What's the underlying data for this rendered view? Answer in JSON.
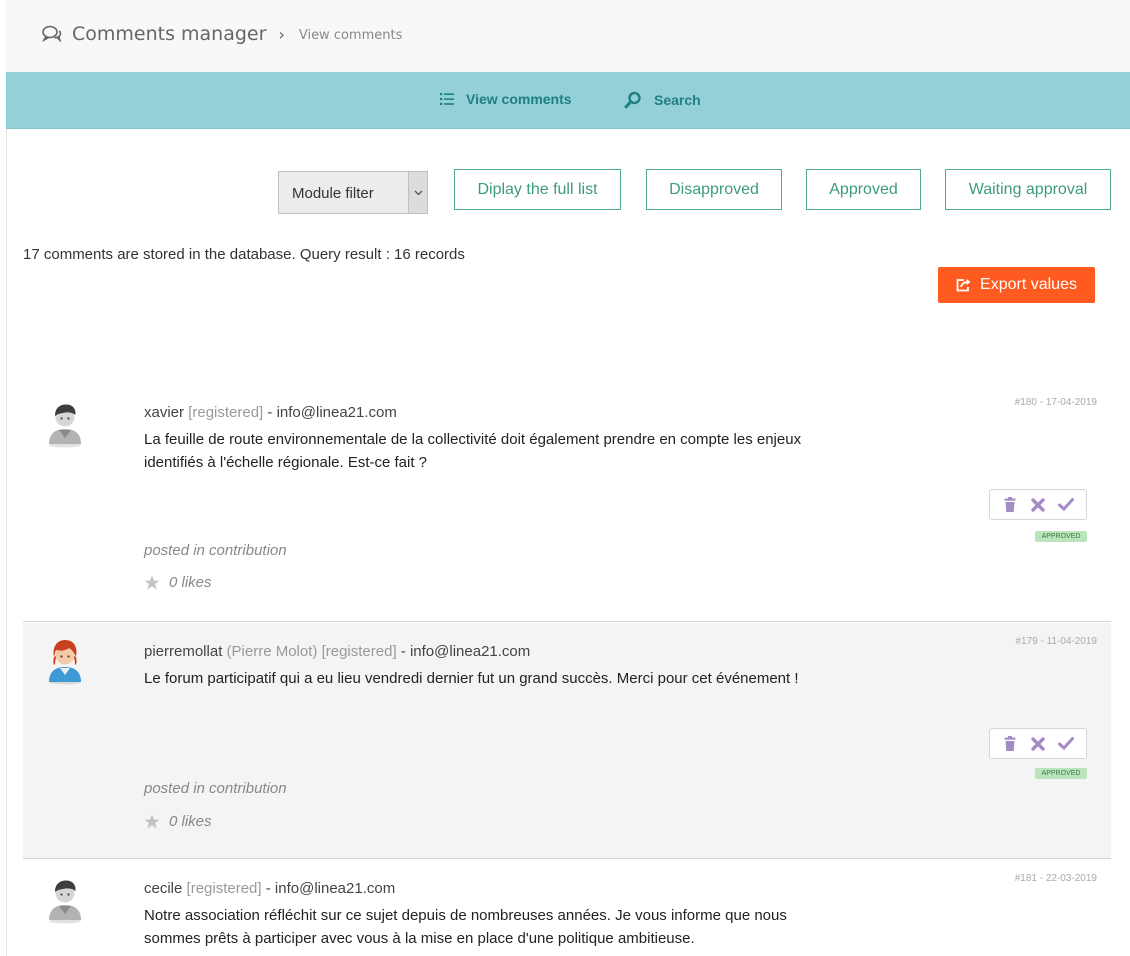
{
  "breadcrumb": {
    "icon": "comments-icon",
    "title": "Comments manager",
    "separator": "›",
    "current": "View comments"
  },
  "tabs": [
    {
      "label": "View comments",
      "icon": "list-icon"
    },
    {
      "label": "Search",
      "icon": "search-icon"
    }
  ],
  "filters": {
    "module_select": "Module filter",
    "buttons": [
      "Diplay the full list",
      "Disapproved",
      "Approved",
      "Waiting approval"
    ]
  },
  "summary": "17 comments are stored in the database. Query result : 16 records",
  "export_label": "Export values",
  "colors": {
    "tabbar": "#93d1d6",
    "accent_green": "#3d9c79",
    "export": "#ff5a1f",
    "action_purple": "#a58bc4"
  },
  "comments": [
    {
      "user": "xavier",
      "fullname": "",
      "status": "[registered]",
      "email": "- info@linea21.com",
      "text": "La feuille de route environnementale de la collectivité doit également prendre en compte les enjeux identifiés à l'échelle régionale. Est-ce fait ?",
      "meta": "#180 - 17-04-2019",
      "badge": "APPROVED",
      "posted": "posted in contribution",
      "likes": "0 likes"
    },
    {
      "user": "pierremollat",
      "fullname": "(Pierre Molot)",
      "status": "[registered]",
      "email": "- info@linea21.com",
      "text": "Le forum participatif qui a eu lieu vendredi dernier fut un grand succès. Merci pour cet événement !",
      "meta": "#179 - 11-04-2019",
      "badge": "APPROVED",
      "posted": "posted in contribution",
      "likes": "0 likes"
    },
    {
      "user": "cecile",
      "fullname": "",
      "status": "[registered]",
      "email": "- info@linea21.com",
      "text": "Notre association réfléchit sur ce sujet depuis de nombreuses années. Je vous informe que nous sommes prêts à participer avec vous à la mise en place d'une politique ambitieuse.",
      "meta": "#181 - 22-03-2019"
    }
  ]
}
